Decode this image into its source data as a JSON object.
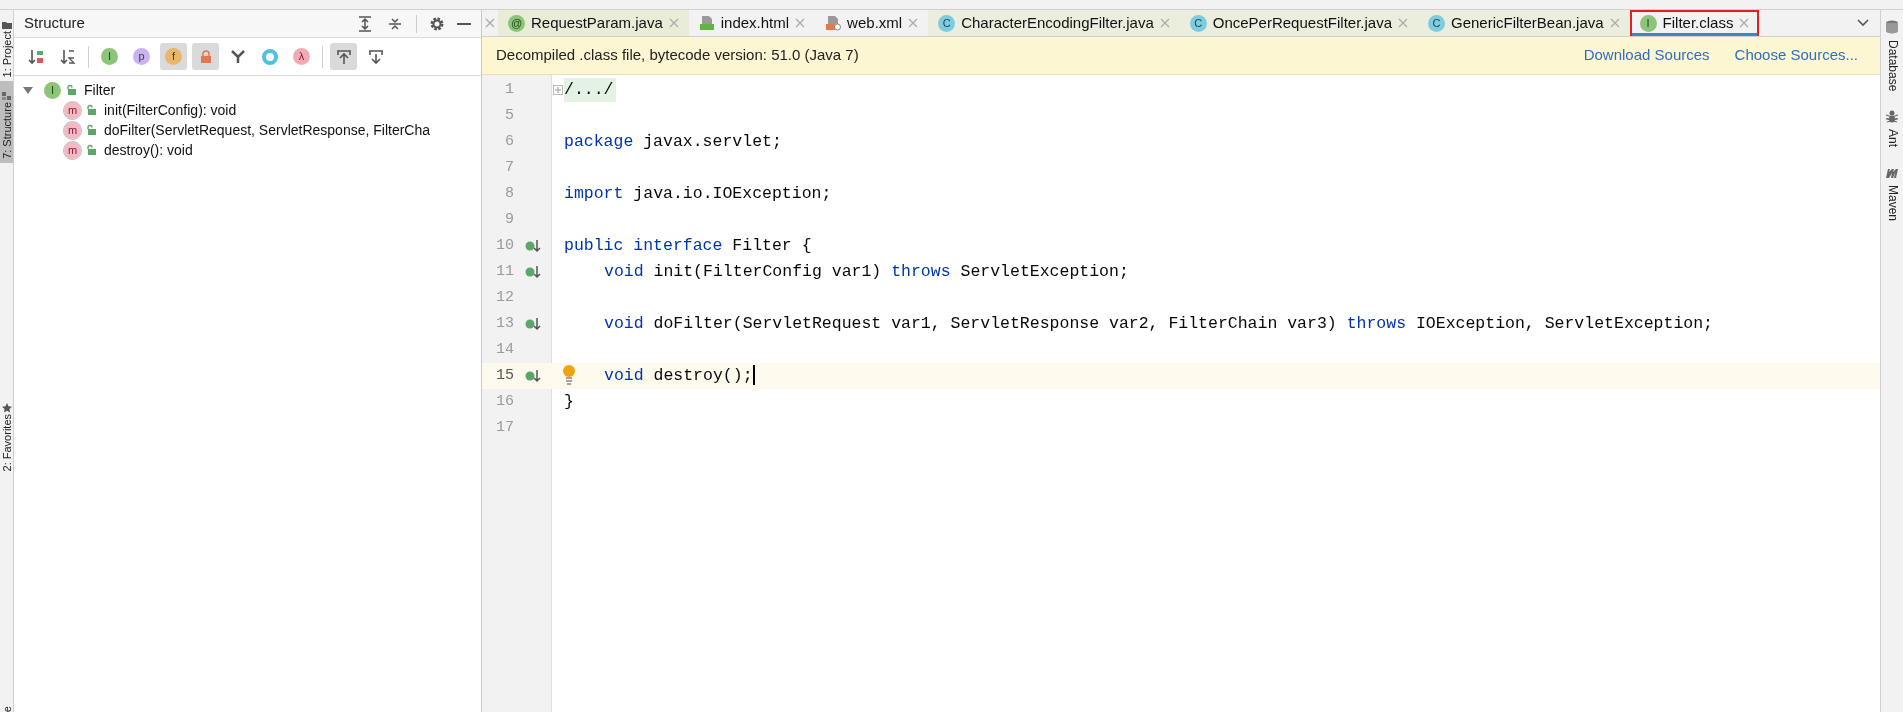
{
  "left_strip": [
    {
      "label": "1: Project",
      "kind": "project",
      "selected": false
    },
    {
      "label": "7: Structure",
      "kind": "structure",
      "selected": true
    },
    {
      "label": "2: Favorites",
      "kind": "favorites",
      "selected": false
    },
    {
      "label": "e",
      "kind": "cut"
    }
  ],
  "structure_panel": {
    "title": "Structure",
    "toolbar": [
      {
        "kind": "sort-visibility",
        "on": false
      },
      {
        "kind": "sort-alpha",
        "on": false
      },
      {
        "kind": "separator"
      },
      {
        "kind": "inherited",
        "glyph": "I",
        "on": false
      },
      {
        "kind": "properties",
        "glyph": "p",
        "on": false
      },
      {
        "kind": "fields",
        "glyph": "f",
        "on": true
      },
      {
        "kind": "non-public",
        "on": true
      },
      {
        "kind": "fork",
        "on": false
      },
      {
        "kind": "ring",
        "on": false
      },
      {
        "kind": "lambda",
        "glyph": "λ",
        "on": false
      },
      {
        "kind": "separator"
      },
      {
        "kind": "scroll-to",
        "on": true
      },
      {
        "kind": "scroll-from",
        "on": false
      }
    ],
    "tree": [
      {
        "name": "Filter",
        "kind": "interface",
        "glyph": "I",
        "expanded": true,
        "children": [
          {
            "name": "init(FilterConfig): void",
            "kind": "method",
            "glyph": "m"
          },
          {
            "name": "doFilter(ServletRequest, ServletResponse, FilterCha",
            "kind": "method",
            "glyph": "m"
          },
          {
            "name": "destroy(): void",
            "kind": "method",
            "glyph": "m"
          }
        ]
      }
    ]
  },
  "tabs": [
    {
      "kind": "cut"
    },
    {
      "label": "RequestParam.java",
      "kind": "annotation",
      "glyph": "@",
      "selected": false,
      "color": "#e9ecd6"
    },
    {
      "label": "index.html",
      "kind": "html",
      "selected": false,
      "color": "#f2f2f2"
    },
    {
      "label": "web.xml",
      "kind": "xml",
      "selected": false,
      "color": "#f2f2f2"
    },
    {
      "label": "CharacterEncodingFilter.java",
      "kind": "class",
      "glyph": "C",
      "selected": false,
      "color": "#eceedd"
    },
    {
      "label": "OncePerRequestFilter.java",
      "kind": "class",
      "glyph": "C",
      "selected": false,
      "color": "#eceedd"
    },
    {
      "label": "GenericFilterBean.java",
      "kind": "class",
      "glyph": "C",
      "selected": false,
      "color": "#eceedd"
    },
    {
      "label": "Filter.class",
      "kind": "interface",
      "glyph": "I",
      "selected": true,
      "color": "#f2f2f2"
    }
  ],
  "banner": {
    "text": "Decompiled .class file, bytecode version: 51.0 (Java 7)",
    "links": [
      "Download Sources",
      "Choose Sources..."
    ]
  },
  "code": [
    {
      "number": "1",
      "folded": true,
      "tokens": [
        {
          "kind": "plain",
          "text": "/.../"
        }
      ]
    },
    {
      "number": "5"
    },
    {
      "number": "6",
      "tokens": [
        {
          "kind": "keyword",
          "text": "package"
        },
        {
          "kind": "plain",
          "text": " javax.servlet;"
        }
      ]
    },
    {
      "number": "7"
    },
    {
      "number": "8",
      "tokens": [
        {
          "kind": "keyword",
          "text": "import"
        },
        {
          "kind": "plain",
          "text": " java.io.IOException;"
        }
      ]
    },
    {
      "number": "9"
    },
    {
      "number": "10",
      "implemented": true,
      "tokens": [
        {
          "kind": "keyword",
          "text": "public interface"
        },
        {
          "kind": "plain",
          "text": " Filter {"
        }
      ]
    },
    {
      "number": "11",
      "implemented": true,
      "indented": true,
      "tokens": [
        {
          "kind": "keyword",
          "text": "void"
        },
        {
          "kind": "plain",
          "text": " init(FilterConfig var1) "
        },
        {
          "kind": "keyword",
          "text": "throws"
        },
        {
          "kind": "plain",
          "text": " ServletException;"
        }
      ]
    },
    {
      "number": "12"
    },
    {
      "number": "13",
      "implemented": true,
      "indented": true,
      "tokens": [
        {
          "kind": "keyword",
          "text": "void"
        },
        {
          "kind": "plain",
          "text": " doFilter(ServletRequest var1, ServletResponse var2, FilterChain var3) "
        },
        {
          "kind": "keyword",
          "text": "throws"
        },
        {
          "kind": "plain",
          "text": " IOException, ServletException;"
        }
      ]
    },
    {
      "number": "14"
    },
    {
      "number": "15",
      "implemented": true,
      "current": true,
      "bulb": true,
      "indented": true,
      "tokens": [
        {
          "kind": "keyword",
          "text": "void"
        },
        {
          "kind": "plain",
          "text": " destroy();"
        }
      ]
    },
    {
      "number": "16",
      "tokens": [
        {
          "kind": "plain",
          "text": "}"
        }
      ]
    },
    {
      "number": "17"
    }
  ],
  "right_strip": [
    {
      "label": "Database",
      "kind": "database"
    },
    {
      "label": "Ant",
      "kind": "ant"
    },
    {
      "label": "Maven",
      "kind": "maven"
    }
  ]
}
